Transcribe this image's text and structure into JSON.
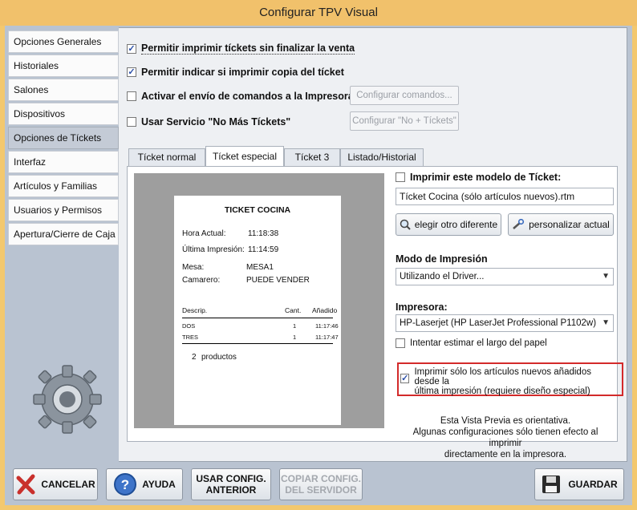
{
  "window": {
    "title": "Configurar TPV Visual",
    "close_glyph": "✕"
  },
  "sidebar": {
    "items": [
      {
        "label": "Opciones Generales"
      },
      {
        "label": "Historiales"
      },
      {
        "label": "Salones"
      },
      {
        "label": "Dispositivos"
      },
      {
        "label": "Opciones de Tíckets"
      },
      {
        "label": "Interfaz"
      },
      {
        "label": "Artículos y Familias"
      },
      {
        "label": "Usuarios y Permisos"
      },
      {
        "label": "Apertura/Cierre de Caja"
      }
    ],
    "active_index": 4
  },
  "options": {
    "print_without_finish": {
      "label": "Permitir imprimir tíckets sin finalizar la venta",
      "checked": true
    },
    "ask_copy": {
      "label": "Permitir indicar si imprimir copia del tícket",
      "checked": true
    },
    "send_commands": {
      "label": "Activar el envío de comandos a la Impresora...",
      "checked": false
    },
    "no_more_tickets": {
      "label": "Usar Servicio \"No Más Tíckets\"",
      "checked": false
    },
    "configure_commands_button": "Configurar comandos...",
    "configure_no_more_button": "Configurar \"No + Tíckets\""
  },
  "tabs": [
    "Tícket normal",
    "Tícket especial",
    "Tícket 3",
    "Listado/Historial"
  ],
  "ticket_preview": {
    "title": "TICKET COCINA",
    "hora_label": "Hora Actual:",
    "hora_value": "11:18:38",
    "ultima_label": "Última Impresión:",
    "ultima_value": "11:14:59",
    "mesa_label": "Mesa:",
    "mesa_value": "MESA1",
    "camarero_label": "Camarero:",
    "camarero_value": "PUEDE VENDER",
    "col_desc": "Descrip.",
    "col_cant": "Cant.",
    "col_added": "Añadido",
    "rows": [
      {
        "desc": "DOS",
        "cant": "1",
        "added": "11:17:46"
      },
      {
        "desc": "TRES",
        "cant": "1",
        "added": "11:17:47"
      }
    ],
    "total_count": "2",
    "total_label": "productos"
  },
  "right_panel": {
    "print_model_label": "Imprimir este modelo de Tícket:",
    "print_model_checked": false,
    "model_file": "Tícket Cocina (sólo artículos nuevos).rtm",
    "choose_button": "elegir otro diferente",
    "customize_button": "personalizar actual",
    "print_mode_label": "Modo de Impresión",
    "print_mode_value": "Utilizando el Driver...",
    "printer_label": "Impresora:",
    "printer_value": "HP-Laserjet (HP LaserJet Professional P1102w)",
    "estimate_label": "Intentar estimar el largo del papel",
    "estimate_checked": false,
    "only_new_label_1": "Imprimir sólo los artículos nuevos añadidos desde la",
    "only_new_label_2": "última impresión (requiere diseño especial)",
    "only_new_checked": true,
    "note_1": "Esta Vista Previa es orientativa.",
    "note_2": "Algunas configuraciones sólo tienen efecto al imprimir",
    "note_3": "directamente en la impresora."
  },
  "footer": {
    "cancel": "CANCELAR",
    "help": "AYUDA",
    "use_prev_1": "USAR CONFIG.",
    "use_prev_2": "ANTERIOR",
    "copy_server_1": "COPIAR CONFIG.",
    "copy_server_2": "DEL SERVIDOR",
    "save": "GUARDAR"
  },
  "colors": {
    "titlebar": "#f1c16b",
    "accent_red": "#d32a2a",
    "check_blue": "#2a4ea8"
  }
}
